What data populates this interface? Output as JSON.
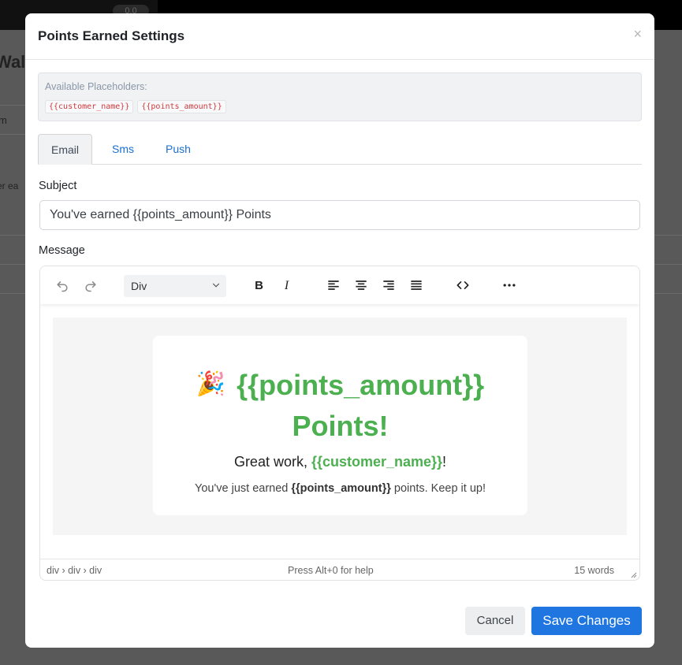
{
  "background": {
    "pill_text": "0.0",
    "title_fragment": "Wall",
    "text_fragment_1": "m",
    "text_fragment_2": "er ea"
  },
  "modal": {
    "title": "Points Earned Settings",
    "close_label": "×"
  },
  "placeholders": {
    "title": "Available Placeholders:",
    "items": [
      "{{customer_name}}",
      "{{points_amount}}"
    ]
  },
  "tabs": [
    {
      "label": "Email",
      "active": true
    },
    {
      "label": "Sms",
      "active": false
    },
    {
      "label": "Push",
      "active": false
    }
  ],
  "subject": {
    "label": "Subject",
    "value": "You've earned {{points_amount}} Points"
  },
  "message": {
    "label": "Message"
  },
  "editor": {
    "block_format": "Div",
    "toolbar_icons": [
      "undo-icon",
      "redo-icon",
      "bold-icon",
      "italic-icon",
      "align-left-icon",
      "align-center-icon",
      "align-right-icon",
      "justify-icon",
      "code-icon",
      "more-icon"
    ],
    "content": {
      "emoji": "🎉",
      "heading": "{{points_amount}} Points!",
      "line1_prefix": "Great work, ",
      "line1_placeholder": "{{customer_name}}",
      "line1_suffix": "!",
      "line2_prefix": "You've just earned ",
      "line2_placeholder": "{{points_amount}}",
      "line2_suffix": " points. Keep it up!",
      "heading_color": "#4caf50"
    },
    "status": {
      "path": "div › div › div",
      "help": "Press Alt+0 for help",
      "word_count": "15 words"
    }
  },
  "footer": {
    "cancel_label": "Cancel",
    "save_label": "Save Changes",
    "save_color": "#1f76e0"
  }
}
